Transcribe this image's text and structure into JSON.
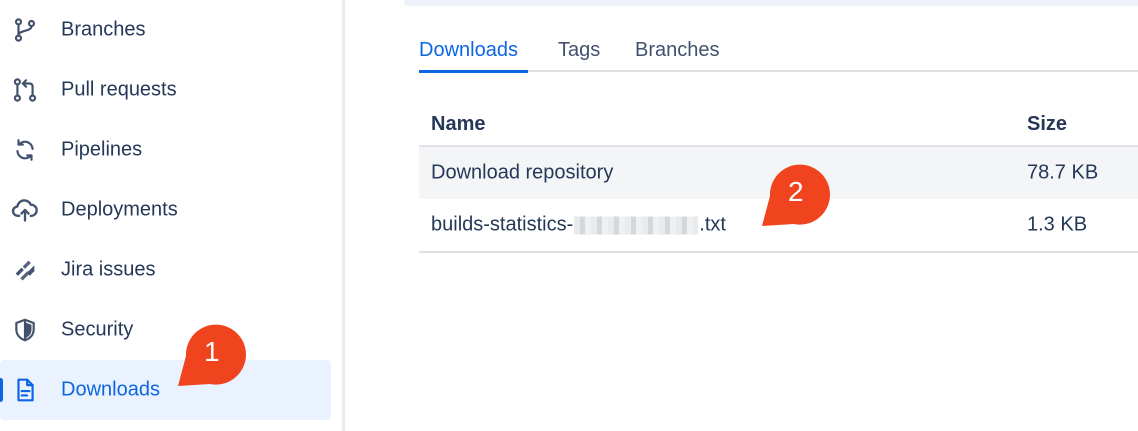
{
  "sidebar": {
    "items": [
      {
        "label": "Branches",
        "icon": "branch-icon"
      },
      {
        "label": "Pull requests",
        "icon": "pull-request-icon"
      },
      {
        "label": "Pipelines",
        "icon": "pipelines-icon"
      },
      {
        "label": "Deployments",
        "icon": "cloud-upload-icon"
      },
      {
        "label": "Jira issues",
        "icon": "jira-icon"
      },
      {
        "label": "Security",
        "icon": "shield-icon"
      },
      {
        "label": "Downloads",
        "icon": "document-icon",
        "active": true
      }
    ]
  },
  "tabs": [
    {
      "label": "Downloads",
      "active": true
    },
    {
      "label": "Tags"
    },
    {
      "label": "Branches"
    }
  ],
  "table": {
    "columns": {
      "name": "Name",
      "size": "Size"
    },
    "rows": [
      {
        "name": "Download repository",
        "size": "78.7 KB"
      },
      {
        "name_prefix": "builds-statistics-",
        "name_suffix": ".txt",
        "size": "1.3 KB"
      }
    ]
  },
  "callouts": [
    "1",
    "2"
  ],
  "colors": {
    "accent": "#0c66e4",
    "callout": "#f0441e",
    "active_bg": "#e9f2fe",
    "text": "#253858"
  }
}
